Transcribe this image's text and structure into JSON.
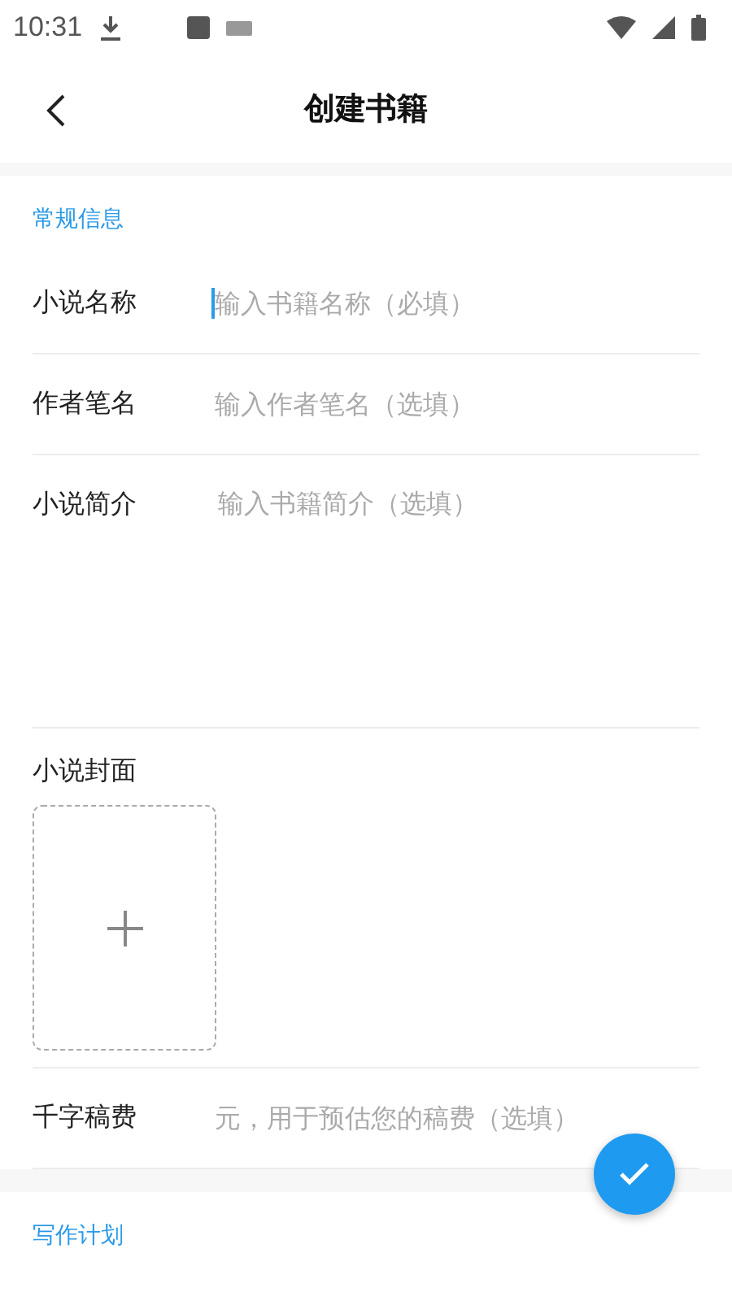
{
  "status_bar": {
    "time": "10:31"
  },
  "header": {
    "title": "创建书籍"
  },
  "sections": [
    {
      "title": "常规信息",
      "fields": [
        {
          "kind": "line",
          "label": "小说名称",
          "placeholder": "输入书籍名称（必填）",
          "focused": true
        },
        {
          "kind": "line",
          "label": "作者笔名",
          "placeholder": "输入作者笔名（选填）",
          "focused": false
        },
        {
          "kind": "area",
          "label": "小说简介",
          "placeholder": "输入书籍简介（选填）",
          "focused": false
        },
        {
          "kind": "cover",
          "label": "小说封面"
        },
        {
          "kind": "line",
          "label": "千字稿费",
          "placeholder": "元，用于预估您的稿费（选填）",
          "focused": false
        }
      ]
    },
    {
      "title": "写作计划"
    }
  ]
}
